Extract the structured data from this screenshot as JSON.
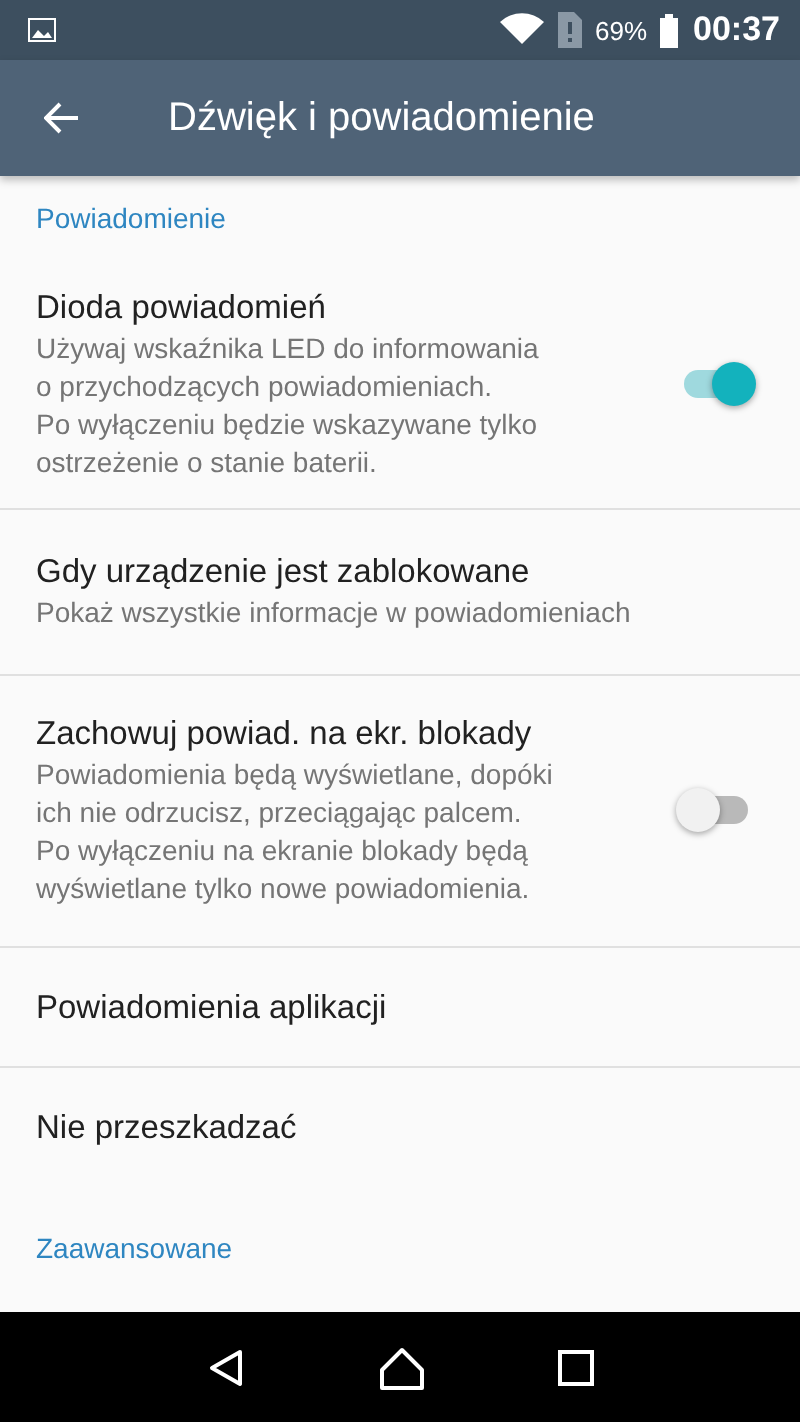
{
  "status_bar": {
    "battery": "69%",
    "time": "00:37"
  },
  "app_bar": {
    "title": "Dźwięk i powiadomienie"
  },
  "sections": [
    {
      "header": "Powiadomienie",
      "items": [
        {
          "kind": "switch",
          "title": "Dioda powiadomień",
          "summary": "Używaj wskaźnika LED do informowania\no przychodzących powiadomieniach.\nPo wyłączeniu będzie wskazywane tylko\nostrzeżenie o stanie baterii.",
          "on": true
        },
        {
          "kind": "plain",
          "title": "Gdy urządzenie jest zablokowane",
          "summary": "Pokaż wszystkie informacje w powiadomieniach"
        },
        {
          "kind": "switch",
          "title": "Zachowuj powiad. na ekr. blokady",
          "summary": "Powiadomienia będą wyświetlane, dopóki\nich nie odrzucisz, przeciągając palcem.\nPo wyłączeniu na ekranie blokady będą\nwyświetlane tylko nowe powiadomienia.",
          "on": false
        },
        {
          "kind": "plain",
          "title": "Powiadomienia aplikacji"
        },
        {
          "kind": "plain",
          "title": "Nie przeszkadzać"
        }
      ]
    },
    {
      "header": "Zaawansowane"
    }
  ]
}
